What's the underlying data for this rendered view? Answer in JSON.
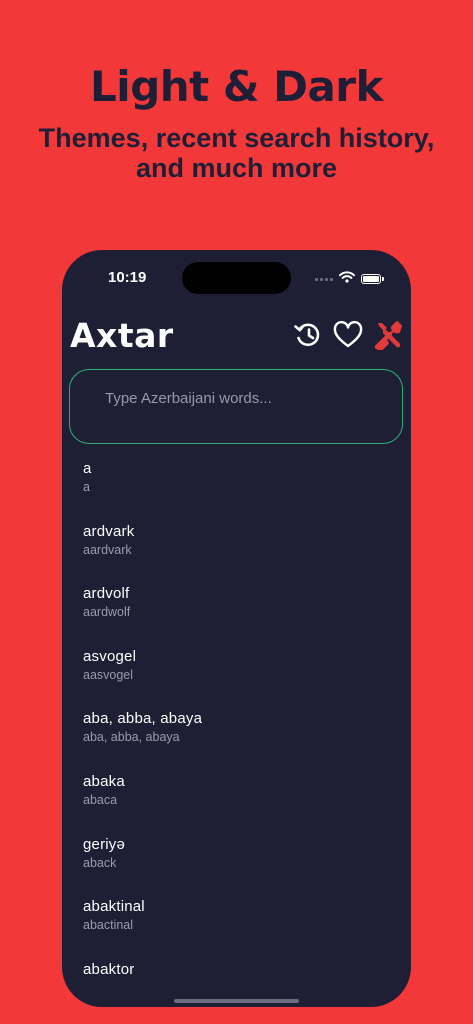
{
  "promo": {
    "headline": "Light & Dark",
    "subline_1": "Themes, recent search history,",
    "subline_2": "and much more"
  },
  "status_bar": {
    "time": "10:19",
    "icons": [
      "signal-dots-icon",
      "wifi-icon",
      "battery-icon"
    ]
  },
  "app": {
    "title": "Axtar",
    "toolbar_icons": [
      "history-icon",
      "heart-icon",
      "tools-icon"
    ],
    "accent_color": "#e23a3a",
    "search": {
      "placeholder": "Type Azerbaijani words...",
      "value": ""
    },
    "words": [
      {
        "title": "a",
        "sub": "a"
      },
      {
        "title": "ardvark",
        "sub": "aardvark"
      },
      {
        "title": "ardvolf",
        "sub": "aardwolf"
      },
      {
        "title": "asvogel",
        "sub": "aasvogel"
      },
      {
        "title": "aba, abba, abaya",
        "sub": "aba, abba, abaya"
      },
      {
        "title": "abaka",
        "sub": "abaca"
      },
      {
        "title": "geriyə",
        "sub": "aback"
      },
      {
        "title": "abaktinal",
        "sub": "abactinal"
      },
      {
        "title": "abaktor",
        "sub": ""
      }
    ]
  },
  "colors": {
    "background": "#f23838",
    "phone_background": "#1e1f35",
    "search_border": "#2fae72",
    "headline": "#1e1f36"
  }
}
